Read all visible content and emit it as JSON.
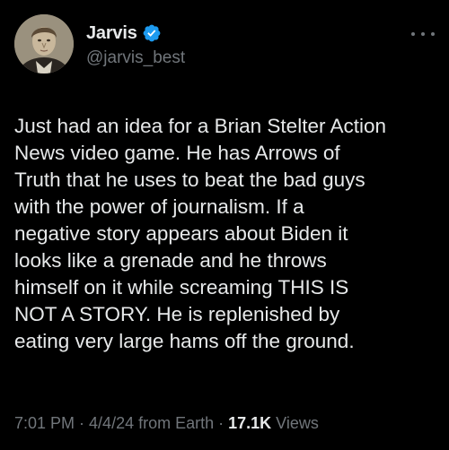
{
  "author": {
    "display_name": "Jarvis",
    "handle": "@jarvis_best",
    "avatar_icon": "portrait-avatar",
    "verified_icon": "verified-badge-icon",
    "verified_color": "#1d9bf0"
  },
  "tweet": {
    "lines": [
      "Just had an idea for a Brian Stelter Action",
      "News video game. He has Arrows of",
      "Truth that he uses to beat the bad guys",
      "with the power of journalism. If a",
      "negative story appears about Biden it",
      "looks like a grenade and he throws",
      "himself on it while screaming THIS IS",
      "NOT A STORY. He is replenished by",
      "eating very large hams off the ground."
    ]
  },
  "meta": {
    "time": "7:01 PM",
    "sep1": " · ",
    "date": "4/4/24",
    "source": " from Earth",
    "sep2": " · ",
    "views_count": "17.1K",
    "views_label": " Views"
  },
  "colors": {
    "background": "#000000",
    "primary_text": "#e7e9ea",
    "secondary_text": "#71767b",
    "accent": "#1d9bf0"
  }
}
